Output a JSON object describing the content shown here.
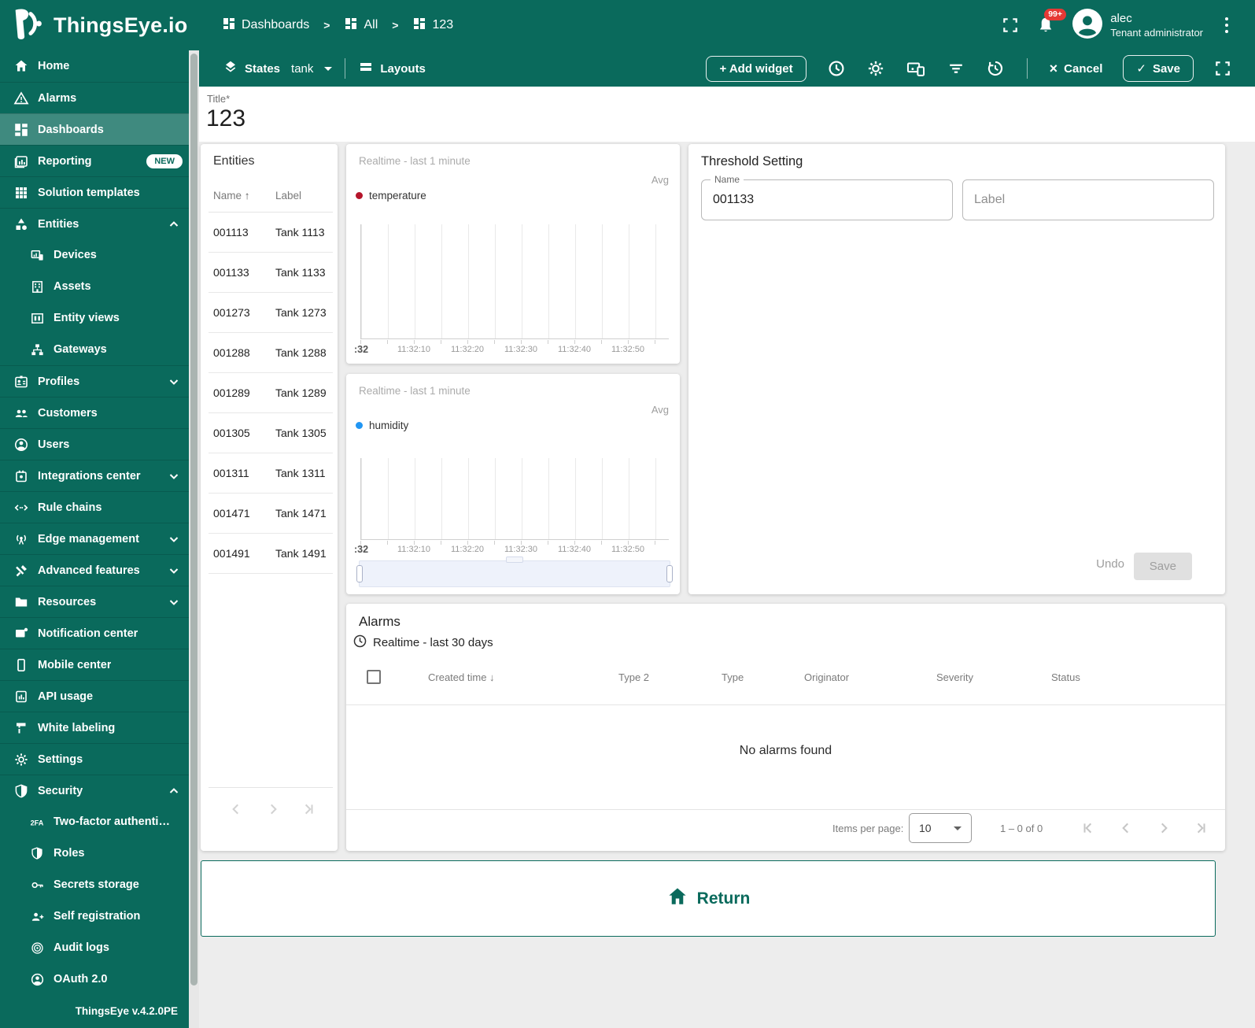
{
  "brand": {
    "name": "ThingsEye.io"
  },
  "header": {
    "breadcrumbs": [
      {
        "label": "Dashboards"
      },
      {
        "label": "All"
      },
      {
        "label": "123"
      }
    ],
    "notification_badge": "99+",
    "user": {
      "name": "alec",
      "role": "Tenant administrator"
    }
  },
  "toolbar": {
    "states_label": "States",
    "states_value": "tank",
    "layouts_label": "Layouts",
    "add_widget_label": "+ Add widget",
    "cancel_glyph": "×",
    "cancel_label": "Cancel",
    "save_glyph": "✓",
    "save_label": "Save"
  },
  "title_bar": {
    "label": "Title*",
    "value": "123"
  },
  "sidebar": {
    "footer": "ThingsEye v.4.2.0PE",
    "badge_new": "NEW",
    "items": [
      {
        "label": "Home"
      },
      {
        "label": "Alarms"
      },
      {
        "label": "Dashboards"
      },
      {
        "label": "Reporting"
      },
      {
        "label": "Solution templates"
      },
      {
        "label": "Entities"
      },
      {
        "label": "Devices"
      },
      {
        "label": "Assets"
      },
      {
        "label": "Entity views"
      },
      {
        "label": "Gateways"
      },
      {
        "label": "Profiles"
      },
      {
        "label": "Customers"
      },
      {
        "label": "Users"
      },
      {
        "label": "Integrations center"
      },
      {
        "label": "Rule chains"
      },
      {
        "label": "Edge management"
      },
      {
        "label": "Advanced features"
      },
      {
        "label": "Resources"
      },
      {
        "label": "Notification center"
      },
      {
        "label": "Mobile center"
      },
      {
        "label": "API usage"
      },
      {
        "label": "White labeling"
      },
      {
        "label": "Settings"
      },
      {
        "label": "Security"
      },
      {
        "label": "Two-factor authenticati…"
      },
      {
        "label": "Roles"
      },
      {
        "label": "Secrets storage"
      },
      {
        "label": "Self registration"
      },
      {
        "label": "Audit logs"
      },
      {
        "label": "OAuth 2.0"
      }
    ]
  },
  "entities_widget": {
    "title": "Entities",
    "col_name": "Name",
    "sort_arrow": "↑",
    "col_label": "Label",
    "rows": [
      {
        "name": "001113",
        "label": "Tank 1113"
      },
      {
        "name": "001133",
        "label": "Tank 1133"
      },
      {
        "name": "001273",
        "label": "Tank 1273"
      },
      {
        "name": "001288",
        "label": "Tank 1288"
      },
      {
        "name": "001289",
        "label": "Tank 1289"
      },
      {
        "name": "001305",
        "label": "Tank 1305"
      },
      {
        "name": "001311",
        "label": "Tank 1311"
      },
      {
        "name": "001471",
        "label": "Tank 1471"
      },
      {
        "name": "001491",
        "label": "Tank 1491"
      }
    ]
  },
  "temperature_chart": {
    "timewindow": "Realtime - last 1 minute",
    "aggregation": "Avg",
    "legend": "temperature",
    "legend_color": "#b5152b",
    "ticks": [
      ":32",
      "11:32:10",
      "11:32:20",
      "11:32:30",
      "11:32:40",
      "11:32:50"
    ]
  },
  "humidity_chart": {
    "timewindow": "Realtime - last 1 minute",
    "aggregation": "Avg",
    "legend": "humidity",
    "legend_color": "#2196f3",
    "ticks": [
      ":32",
      "11:32:10",
      "11:32:20",
      "11:32:30",
      "11:32:40",
      "11:32:50"
    ]
  },
  "chart_data": [
    {
      "type": "line",
      "title": "Realtime - last 1 minute",
      "aggregation": "Avg",
      "series": [
        {
          "name": "temperature",
          "color": "#b5152b",
          "x": [],
          "y": []
        }
      ],
      "x_ticks": [
        ":32",
        "11:32:10",
        "11:32:20",
        "11:32:30",
        "11:32:40",
        "11:32:50"
      ],
      "x_range": [
        "11:32:00",
        "11:33:00"
      ],
      "grid": "vertical gridlines every 5s",
      "legend_position": "top-left",
      "note": "empty chart - no data points rendered"
    },
    {
      "type": "line",
      "title": "Realtime - last 1 minute",
      "aggregation": "Avg",
      "series": [
        {
          "name": "humidity",
          "color": "#2196f3",
          "x": [],
          "y": []
        }
      ],
      "x_ticks": [
        ":32",
        "11:32:10",
        "11:32:20",
        "11:32:30",
        "11:32:40",
        "11:32:50"
      ],
      "x_range": [
        "11:32:00",
        "11:33:00"
      ],
      "grid": "vertical gridlines every 5s",
      "legend_position": "top-left",
      "has_datazoom_slider": true,
      "note": "empty chart - no data points rendered"
    }
  ],
  "threshold_widget": {
    "title": "Threshold Setting",
    "name_label": "Name",
    "name_value": "001133",
    "label_placeholder": "Label",
    "undo_label": "Undo",
    "save_label": "Save"
  },
  "alarms_widget": {
    "title": "Alarms",
    "timewindow": "Realtime - last 30 days",
    "sort_arrow": "↓",
    "columns": [
      "Created time",
      "Type 2",
      "Type",
      "Originator",
      "Severity",
      "Status"
    ],
    "empty_text": "No alarms found",
    "items_per_page_label": "Items per page:",
    "items_per_page_value": "10",
    "range_text": "1 – 0 of 0"
  },
  "return_widget": {
    "label": "Return"
  },
  "colors": {
    "primary": "#0a6a5c",
    "badge_red": "#e53935",
    "temperature_series": "#b5152b",
    "humidity_series": "#2196f3",
    "content_bg": "#ededed"
  }
}
